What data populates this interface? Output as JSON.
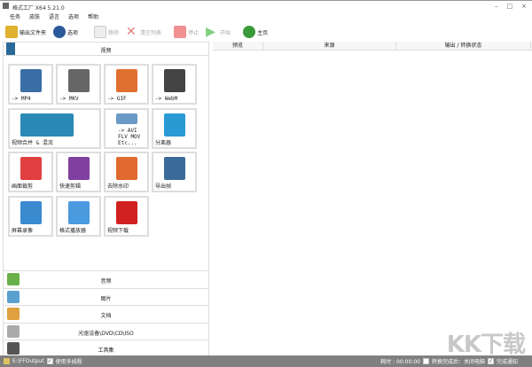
{
  "window": {
    "title": "格式工厂 X64 5.21.0",
    "minimize": "–",
    "maximize": "□",
    "close": "×"
  },
  "menu": [
    "任务",
    "皮肤",
    "语言",
    "选项",
    "帮助"
  ],
  "toolbar": {
    "output_folder": "输出文件夹",
    "options": "选项",
    "remove": "移除",
    "clear_list": "清空列表",
    "stop": "停止",
    "start": "开始",
    "home": "主页"
  },
  "video": {
    "header": "视频",
    "tiles": [
      {
        "label": "-> MP4",
        "color": "#3a6ea5"
      },
      {
        "label": "-> MKV",
        "color": "#666"
      },
      {
        "label": "-> GIF",
        "color": "#e07030"
      },
      {
        "label": "-> WebM",
        "color": "#444"
      },
      {
        "label": "视频合并 & 混流",
        "color": "#2a8ab5"
      },
      {
        "label": "-> AVI FLV MOV Etc...",
        "color": "#6a9ac5"
      },
      {
        "label": "分离器",
        "color": "#2a9ad5"
      },
      {
        "label": "画面裁剪",
        "color": "#e04040"
      },
      {
        "label": "快速剪辑",
        "color": "#8040a0"
      },
      {
        "label": "去除水印",
        "color": "#e06a30"
      },
      {
        "label": "导出帧",
        "color": "#3a6a9a"
      },
      {
        "label": "屏幕录像",
        "color": "#3a8ad0"
      },
      {
        "label": "格式播放器",
        "color": "#4a9ae0"
      },
      {
        "label": "视频下载",
        "color": "#d02020"
      }
    ]
  },
  "categories": [
    {
      "label": "音频",
      "color": "#6ab04a"
    },
    {
      "label": "图片",
      "color": "#5aa0d0"
    },
    {
      "label": "文档",
      "color": "#e0a040"
    },
    {
      "label": "光驱设备\\DVD\\CD\\ISO",
      "color": "#aaa"
    },
    {
      "label": "工具集",
      "color": "#555"
    }
  ],
  "table": {
    "columns": [
      "预览",
      "来源",
      "输出 / 转换状态"
    ]
  },
  "status": {
    "output_path": "E:\\FFOutput",
    "multithread": "使用多线程",
    "elapsed": "耗时 : 00:00:00",
    "after_convert": "转换完成后：关闭电脑",
    "notify": "完成通知"
  },
  "watermark": "KK下载"
}
